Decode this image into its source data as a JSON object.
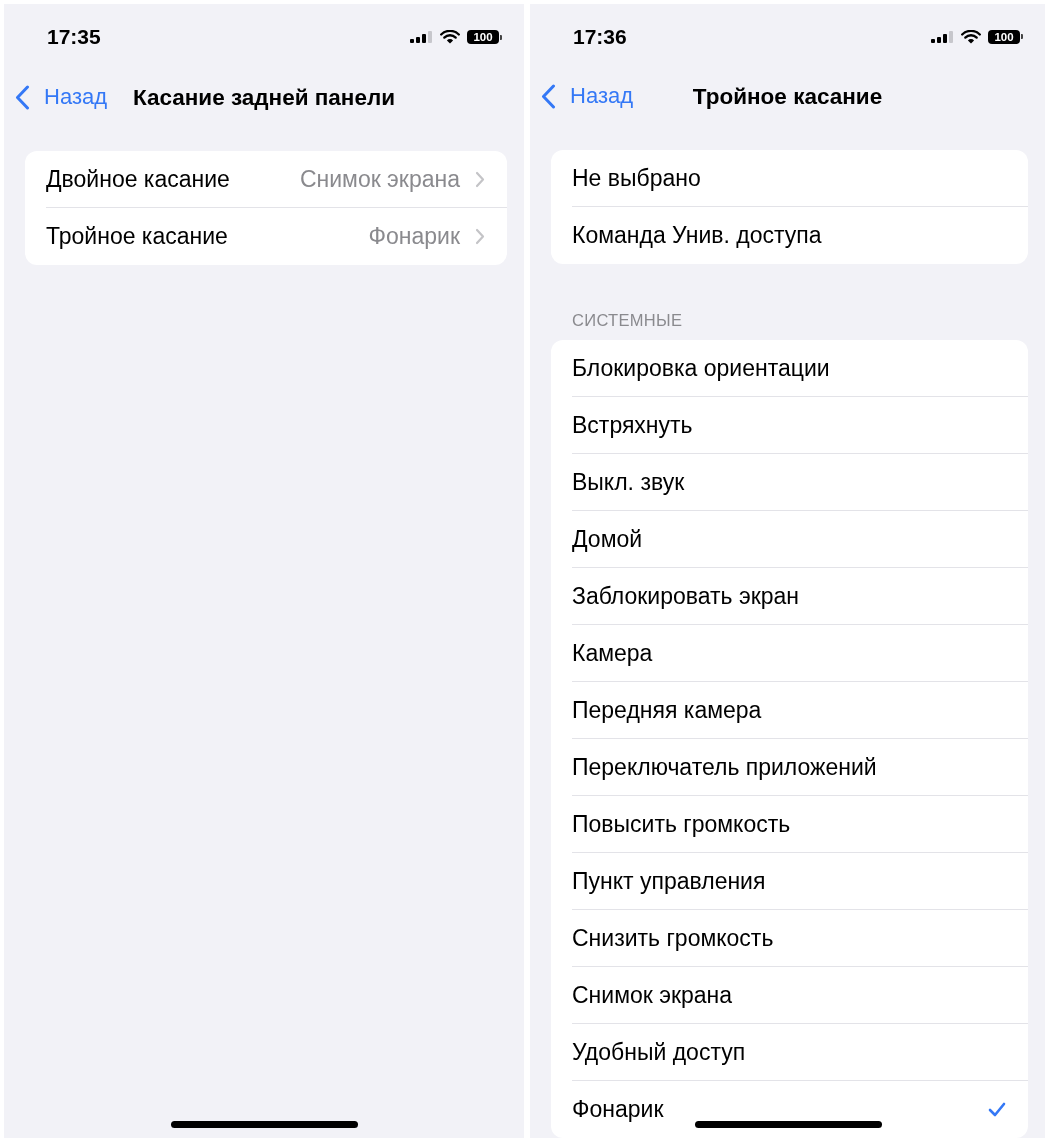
{
  "screens": [
    {
      "status_bar": {
        "time": "17:35",
        "battery": "100"
      },
      "nav_bar": {
        "back": "Назад",
        "title": "Касание задней панели"
      },
      "groups": [
        {
          "rows": [
            {
              "label": "Двойное касание",
              "value": "Снимок экрана"
            },
            {
              "label": "Тройное касание",
              "value": "Фонарик"
            }
          ]
        }
      ]
    },
    {
      "status_bar": {
        "time": "17:36",
        "battery": "100"
      },
      "nav_bar": {
        "back": "Назад",
        "title": "Тройное касание"
      },
      "groups": [
        {
          "rows": [
            {
              "label": "Не выбрано",
              "selected": false
            },
            {
              "label": "Команда Унив. доступа",
              "selected": false
            }
          ]
        },
        {
          "header": "СИСТЕМНЫЕ",
          "rows": [
            {
              "label": "Блокировка ориентации",
              "selected": false
            },
            {
              "label": "Встряхнуть",
              "selected": false
            },
            {
              "label": "Выкл. звук",
              "selected": false
            },
            {
              "label": "Домой",
              "selected": false
            },
            {
              "label": "Заблокировать экран",
              "selected": false
            },
            {
              "label": "Камера",
              "selected": false
            },
            {
              "label": "Передняя камера",
              "selected": false
            },
            {
              "label": "Переключатель приложений",
              "selected": false
            },
            {
              "label": "Повысить громкость",
              "selected": false
            },
            {
              "label": "Пункт управления",
              "selected": false
            },
            {
              "label": "Снизить громкость",
              "selected": false
            },
            {
              "label": "Снимок экрана",
              "selected": false
            },
            {
              "label": "Удобный доступ",
              "selected": false
            },
            {
              "label": "Фонарик",
              "selected": true
            }
          ]
        }
      ]
    }
  ]
}
